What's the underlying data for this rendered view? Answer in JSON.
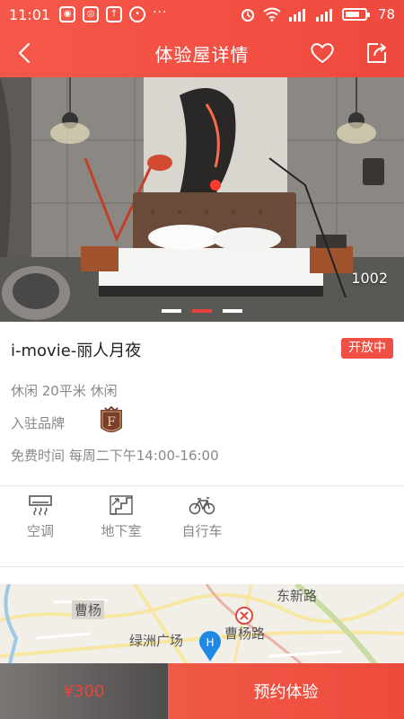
{
  "statusbar": {
    "time": "11:01",
    "battery": "78",
    "notif_icons": [
      "wechat-icon",
      "weibo-icon",
      "upload-icon",
      "chat-icon"
    ],
    "more": "···"
  },
  "header": {
    "title": "体验屋详情",
    "back_icon": "chevron-left-icon",
    "favorite_icon": "heart-icon",
    "share_icon": "share-icon"
  },
  "hero": {
    "room_number": "1002",
    "carousel": {
      "count": 3,
      "active_index": 1
    }
  },
  "room": {
    "name": "i-movie-丽人月夜",
    "status": "开放中",
    "meta": "休闲 20平米 休闲",
    "brand_label": "入驻品牌",
    "free_time": "免费时间 每周二下午14:00-16:00"
  },
  "amenities": [
    {
      "label": "空调",
      "icon": "air-conditioner-icon"
    },
    {
      "label": "地下室",
      "icon": "stairs-icon"
    },
    {
      "label": "自行车",
      "icon": "bicycle-icon"
    }
  ],
  "map": {
    "labels": [
      "曹杨",
      "东新路",
      "绿洲广场",
      "曹杨路"
    ],
    "pin_letter": "H"
  },
  "bottom": {
    "price": "¥300",
    "book_label": "预约体验"
  },
  "colors": {
    "accent": "#f0493d",
    "price_text": "#e8443a"
  }
}
